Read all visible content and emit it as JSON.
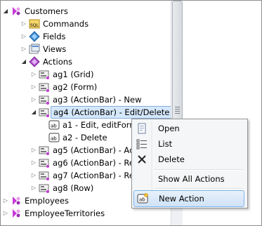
{
  "tree": {
    "nodes": [
      {
        "label": "Customers",
        "icon": "controller-icon",
        "expanded": true
      },
      {
        "label": "Commands",
        "icon": "sql-command-icon",
        "expanded": false
      },
      {
        "label": "Fields",
        "icon": "fields-icon",
        "expanded": false
      },
      {
        "label": "Views",
        "icon": "views-icon",
        "expanded": false
      },
      {
        "label": "Actions",
        "icon": "actions-icon",
        "expanded": true
      },
      {
        "label": "ag1 (Grid)",
        "icon": "action-group-icon",
        "expanded": false
      },
      {
        "label": "ag2 (Form)",
        "icon": "action-group-icon",
        "expanded": false
      },
      {
        "label": "ag3 (ActionBar) - New",
        "icon": "action-group-icon",
        "expanded": false
      },
      {
        "label": "ag4 (ActionBar) - Edit/Delete",
        "icon": "action-group-icon",
        "expanded": true,
        "selected": true
      },
      {
        "label": "a1 - Edit, editForm1",
        "icon": "action-icon"
      },
      {
        "label": "a2 - Delete",
        "icon": "action-icon"
      },
      {
        "label": "ag5 (ActionBar) - Actions",
        "icon": "action-group-icon",
        "expanded": false
      },
      {
        "label": "ag6 (ActionBar) - Record",
        "icon": "action-group-icon",
        "expanded": false
      },
      {
        "label": "ag7 (ActionBar) - Report",
        "icon": "action-group-icon",
        "expanded": false
      },
      {
        "label": "ag8 (Row)",
        "icon": "action-group-icon",
        "expanded": false
      },
      {
        "label": "Employees",
        "icon": "controller-icon",
        "expanded": false
      },
      {
        "label": "EmployeeTerritories",
        "icon": "controller-icon",
        "expanded": false
      }
    ]
  },
  "context_menu": {
    "items": [
      {
        "label": "Open",
        "icon": "open-icon"
      },
      {
        "label": "List",
        "icon": "list-icon"
      },
      {
        "label": "Delete",
        "icon": "delete-icon"
      },
      {
        "label": "Show All Actions",
        "icon": ""
      },
      {
        "label": "New Action",
        "icon": "new-action-icon",
        "highlighted": true
      }
    ]
  },
  "colors": {
    "selection_bg": "#d5e8fb",
    "selection_border": "#84acdd",
    "menu_hover_border": "#7eb4ea",
    "controller_pink": "#c63ad6",
    "actions_purple": "#b04fd0"
  }
}
